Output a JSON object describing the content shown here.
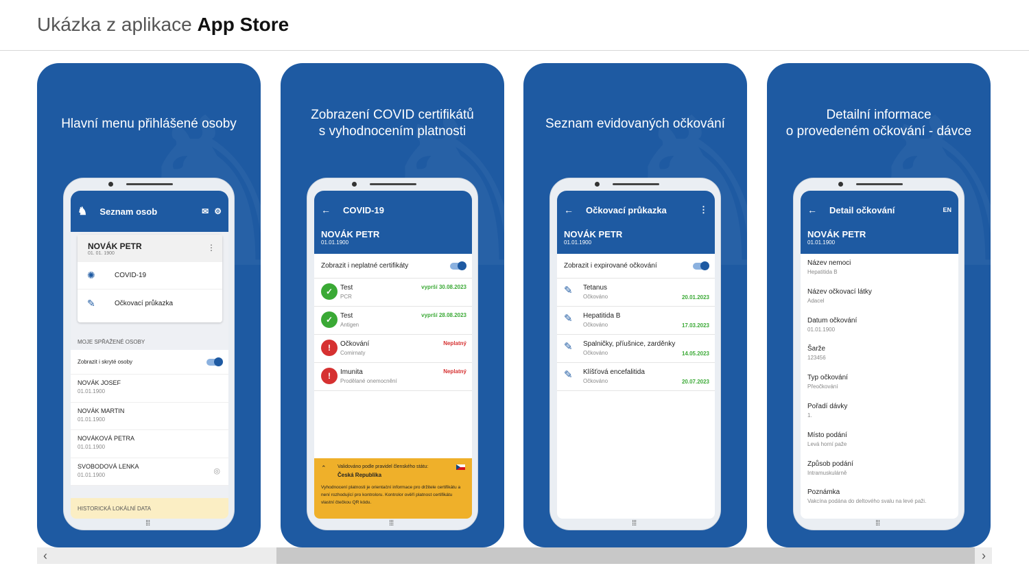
{
  "header": {
    "prefix": "Ukázka z aplikace",
    "store": "App Store"
  },
  "cards": [
    {
      "title": "Hlavní menu přihlášené osoby",
      "screen": {
        "bar_title": "Seznam osob",
        "person": {
          "name": "NOVÁK PETR",
          "dob": "01. 01. 1900"
        },
        "menu": [
          {
            "label": "COVID-19",
            "icon": "virus-icon"
          },
          {
            "label": "Očkovací průkazka",
            "icon": "syringe-icon"
          }
        ],
        "section": "MOJE SPŘAŽENÉ OSOBY",
        "toggle_label": "Zobrazit i skryté osoby",
        "people": [
          {
            "name": "NOVÁK JOSEF",
            "dob": "01.01.1900"
          },
          {
            "name": "NOVÁK MARTIN",
            "dob": "01.01.1900"
          },
          {
            "name": "NOVÁKOVÁ PETRA",
            "dob": "01.01.1900"
          },
          {
            "name": "SVOBODOVÁ LENKA",
            "dob": "01.01.1900"
          }
        ],
        "history": "HISTORICKÁ LOKÁLNÍ DATA"
      }
    },
    {
      "title_l1": "Zobrazení COVID certifikátů",
      "title_l2": "s vyhodnocením platnosti",
      "screen": {
        "bar_title": "COVID-19",
        "name": "NOVÁK PETR",
        "dob": "01.01.1900",
        "toggle_label": "Zobrazit i neplatné certifikáty",
        "certs": [
          {
            "title": "Test",
            "sub": "PCR",
            "status": "vyprší 30.08.2023",
            "color": "#3aa935"
          },
          {
            "title": "Test",
            "sub": "Antigen",
            "status": "vyprší 28.08.2023",
            "color": "#3aa935"
          },
          {
            "title": "Očkování",
            "sub": "Comirnaty",
            "status": "Neplatný",
            "color": "#d63131"
          },
          {
            "title": "Imunita",
            "sub": "Prodělané onemocnění",
            "status": "Neplatný",
            "color": "#d63131"
          }
        ],
        "banner": {
          "line1": "Validováno podle pravidel členského státu:",
          "line2": "Česká Republika",
          "note": "Vyhodnocení platnosti je orientační informace pro držitele certifikátu a není rozhodující pro kontroloru. Kontrolor ověří platnost certifikátu vlastní čtečkou QR kódu."
        }
      }
    },
    {
      "title": "Seznam evidovaných očkování",
      "screen": {
        "bar_title": "Očkovací průkazka",
        "name": "NOVÁK PETR",
        "dob": "01.01.1900",
        "toggle_label": "Zobrazit i expirované očkování",
        "vaccines": [
          {
            "title": "Tetanus",
            "sub": "Očkováno",
            "date": "20.01.2023"
          },
          {
            "title": "Hepatitida B",
            "sub": "Očkováno",
            "date": "17.03.2023"
          },
          {
            "title": "Spalničky, příušnice, zarděnky",
            "sub": "Očkováno",
            "date": "14.05.2023"
          },
          {
            "title": "Klíšťová encefalitida",
            "sub": "Očkováno",
            "date": "20.07.2023"
          }
        ]
      }
    },
    {
      "title_l1": "Detailní informace",
      "title_l2": "o provedeném očkování - dávce",
      "screen": {
        "bar_title": "Detail očkování",
        "lang": "EN",
        "name": "NOVÁK PETR",
        "dob": "01.01.1900",
        "fields": [
          {
            "k": "Název nemoci",
            "v": "Hepatitida B"
          },
          {
            "k": "Název očkovací látky",
            "v": "Adacel"
          },
          {
            "k": "Datum očkování",
            "v": "01.01.1900"
          },
          {
            "k": "Šarže",
            "v": "123456"
          },
          {
            "k": "Typ očkování",
            "v": "Přeočkování"
          },
          {
            "k": "Pořadí dávky",
            "v": "1."
          },
          {
            "k": "Místo podání",
            "v": "Levá horní paže"
          },
          {
            "k": "Způsob podání",
            "v": "Intramuskulárně"
          },
          {
            "k": "Poznámka",
            "v": "Vakcína podána do deltového svalu na levé paži."
          }
        ]
      }
    }
  ],
  "scroll": {
    "left": "‹",
    "right": "›"
  }
}
